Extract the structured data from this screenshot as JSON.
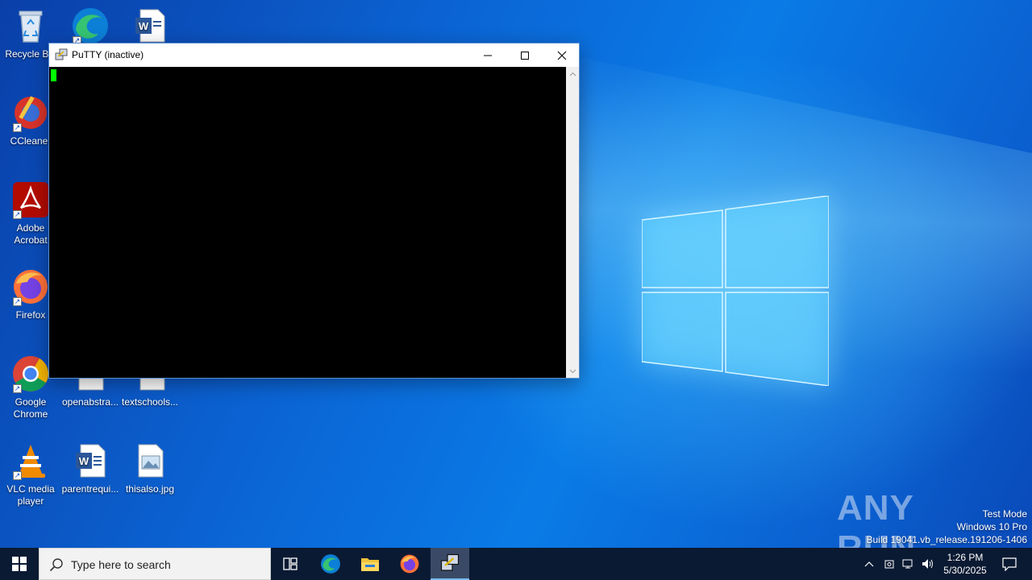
{
  "desktop": {
    "icons": [
      {
        "label": "Recycle Bin"
      },
      {
        "label": "CCleaner"
      },
      {
        "label": "Adobe Acrobat"
      },
      {
        "label": "Firefox"
      },
      {
        "label": "Google Chrome"
      },
      {
        "label": "VLC media player"
      },
      {
        "label": ""
      },
      {
        "label": "openabstra..."
      },
      {
        "label": "parentrequi..."
      },
      {
        "label": ""
      },
      {
        "label": "textschools..."
      },
      {
        "label": "thisalso.jpg"
      }
    ]
  },
  "window": {
    "title": "PuTTY (inactive)",
    "minimize_icon": "minimize-icon",
    "maximize_icon": "maximize-icon",
    "close_icon": "close-icon",
    "terminal_bg": "#000000",
    "cursor_color": "#00ff00"
  },
  "watermark": {
    "text": "ANY RUN",
    "test_mode": "Test Mode",
    "edition": "Windows 10 Pro",
    "build": "Build 19041.vb_release.191206-1406"
  },
  "taskbar": {
    "search_placeholder": "Type here to search",
    "clock_time": "1:26 PM",
    "clock_date": "5/30/2025",
    "apps": [
      "task-view",
      "edge",
      "file-explorer",
      "firefox",
      "putty"
    ],
    "active_app": "putty"
  },
  "colors": {
    "taskbar_bg": "#0b1a33",
    "accent": "#0b63d3"
  }
}
